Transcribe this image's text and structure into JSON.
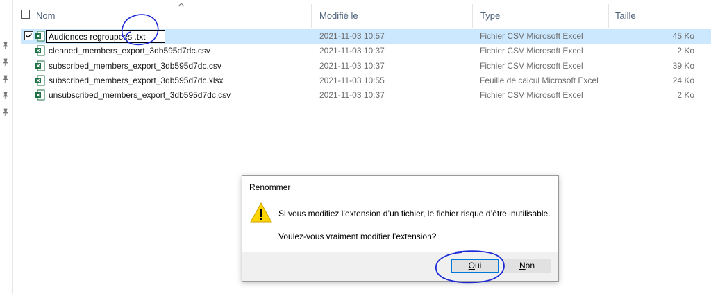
{
  "columns": {
    "name": "Nom",
    "modified": "Modifié le",
    "type": "Type",
    "size": "Taille"
  },
  "files": [
    {
      "name": "Audiences regroupees .txt",
      "modified": "2021-11-03 10:57",
      "type": "Fichier CSV Microsoft Excel",
      "size": "45 Ko",
      "selected": true,
      "renaming": true
    },
    {
      "name": "cleaned_members_export_3db595d7dc.csv",
      "modified": "2021-11-03 10:37",
      "type": "Fichier CSV Microsoft Excel",
      "size": "2 Ko"
    },
    {
      "name": "subscribed_members_export_3db595d7dc.csv",
      "modified": "2021-11-03 10:37",
      "type": "Fichier CSV Microsoft Excel",
      "size": "39 Ko"
    },
    {
      "name": "subscribed_members_export_3db595d7dc.xlsx",
      "modified": "2021-11-03 10:55",
      "type": "Feuille de calcul Microsoft Excel",
      "size": "24 Ko"
    },
    {
      "name": "unsubscribed_members_export_3db595d7dc.csv",
      "modified": "2021-11-03 10:37",
      "type": "Fichier CSV Microsoft Excel",
      "size": "2 Ko"
    }
  ],
  "dialog": {
    "title": "Renommer",
    "message": "Si vous modifiez l’extension d’un fichier, le fichier risque d’être inutilisable.",
    "question": "Voulez-vous vraiment modifier l’extension?",
    "yes_label_mnemonic": "O",
    "yes_label_rest": "ui",
    "no_label_mnemonic": "N",
    "no_label_rest": "on"
  },
  "colors": {
    "selection": "#cce8ff",
    "header_text": "#4c607a",
    "accent": "#0078d7",
    "ink": "#1e2ad6",
    "excel_green": "#1d7044"
  },
  "icons": [
    "pin-icon",
    "excel-file-icon",
    "warning-icon",
    "sort-ascending-icon"
  ]
}
